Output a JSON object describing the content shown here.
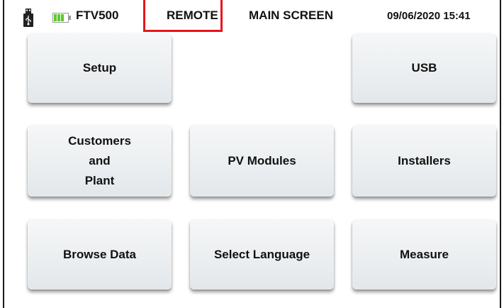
{
  "status_bar": {
    "device": "FTV500",
    "mode": "REMOTE",
    "screen_title": "MAIN SCREEN",
    "datetime": "09/06/2020 15:41",
    "usb_icon": "usb-drive-icon",
    "battery_icon": "battery-icon",
    "battery_color": "#5cc92c",
    "highlight_color": "#e8141b"
  },
  "menu": {
    "setup": "Setup",
    "usb": "USB",
    "customers_plant": "Customers\nand\nPlant",
    "pv_modules": "PV Modules",
    "installers": "Installers",
    "browse_data": "Browse Data",
    "select_language": "Select Language",
    "measure": "Measure"
  }
}
